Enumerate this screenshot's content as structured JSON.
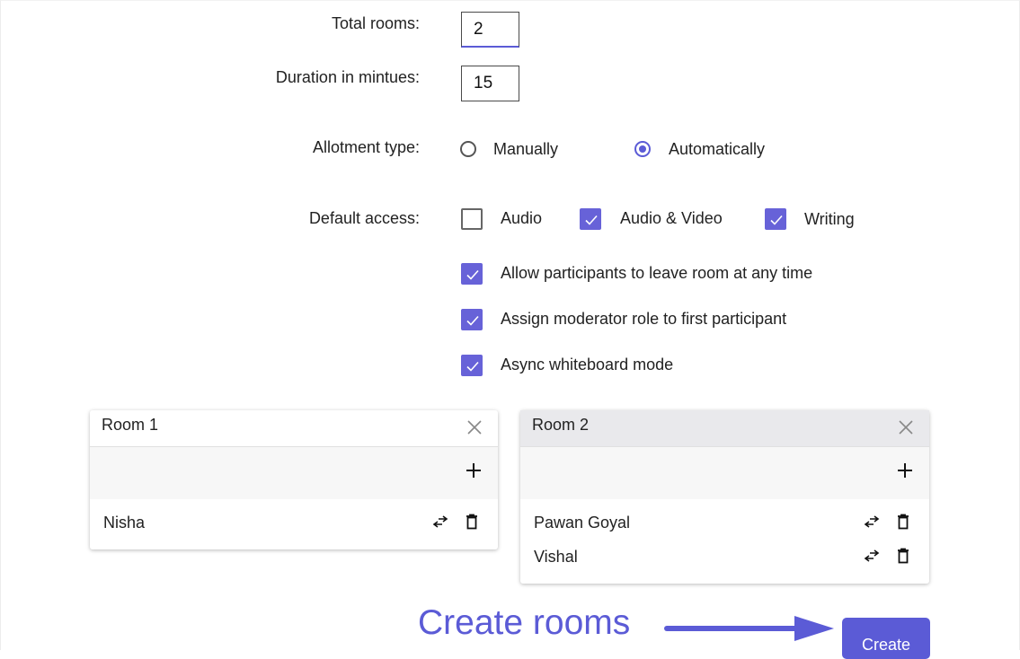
{
  "form": {
    "total_rooms_label": "Total rooms:",
    "total_rooms_value": "2",
    "duration_label": "Duration in mintues:",
    "duration_value": "15",
    "allotment_label": "Allotment type:",
    "allotment_options": [
      {
        "label": "Manually",
        "selected": false
      },
      {
        "label": "Automatically",
        "selected": true
      }
    ],
    "access_label": "Default access:",
    "access_options": [
      {
        "label": "Audio",
        "checked": false
      },
      {
        "label": "Audio & Video",
        "checked": true
      },
      {
        "label": "Writing",
        "checked": true
      }
    ],
    "settings": [
      {
        "label": "Allow participants to leave room at any time",
        "checked": true
      },
      {
        "label": "Assign moderator role to first participant",
        "checked": true
      },
      {
        "label": "Async whiteboard mode",
        "checked": true
      }
    ]
  },
  "rooms": [
    {
      "name": "Room 1",
      "members": [
        "Nisha"
      ]
    },
    {
      "name": "Room 2",
      "members": [
        "Pawan Goyal",
        "Vishal"
      ]
    }
  ],
  "annotation": {
    "text": "Create rooms"
  },
  "actions": {
    "create_label": "Create"
  },
  "icons": {
    "close": "close-icon",
    "add": "plus-icon",
    "move": "swap-arrows-icon",
    "delete": "trash-icon",
    "check": "check-icon",
    "arrow": "arrow-right-icon"
  },
  "colors": {
    "accent": "#5b5bd6",
    "checkbox": "#6762d8",
    "room_header_active": "#e9e9ec"
  }
}
